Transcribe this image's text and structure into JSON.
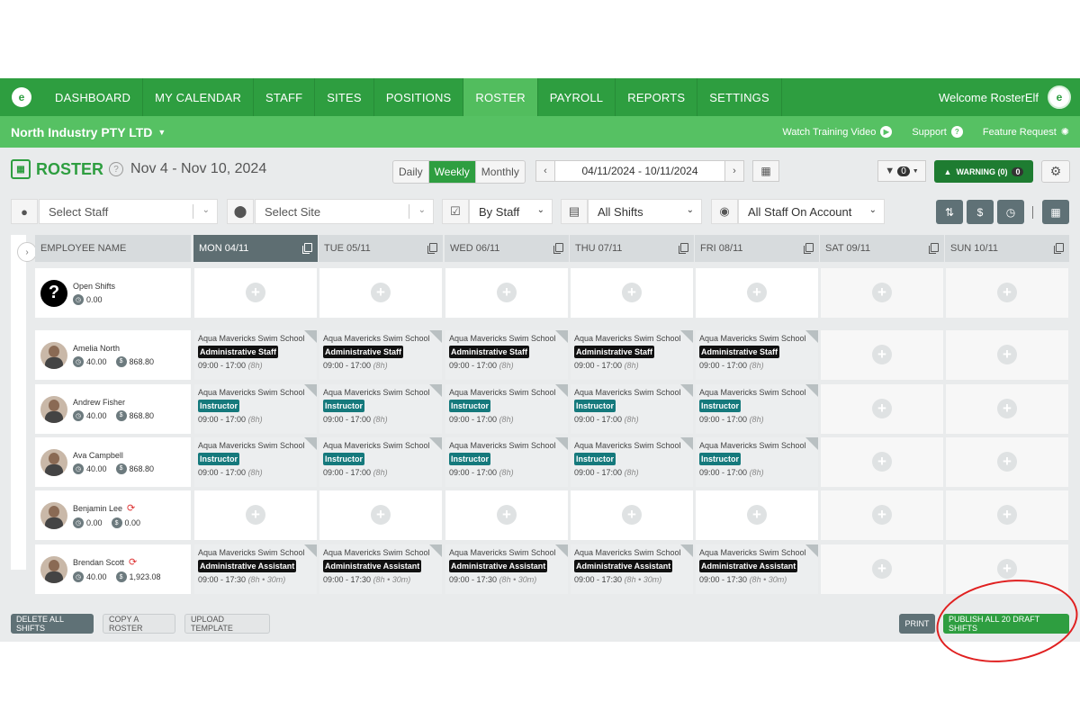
{
  "nav": {
    "items": [
      "DASHBOARD",
      "MY CALENDAR",
      "STAFF",
      "SITES",
      "POSITIONS",
      "ROSTER",
      "PAYROLL",
      "REPORTS",
      "SETTINGS"
    ],
    "active": "ROSTER",
    "welcome": "Welcome RosterElf"
  },
  "subnav": {
    "company": "North Industry PTY LTD",
    "training": "Watch Training Video",
    "support": "Support",
    "feature": "Feature Request"
  },
  "header": {
    "title": "ROSTER",
    "date_range": "Nov 4 - Nov 10, 2024",
    "view_daily": "Daily",
    "view_weekly": "Weekly",
    "view_monthly": "Monthly",
    "date_field": "04/11/2024 - 10/11/2024",
    "filter_count": "0",
    "warning_label": "WARNING (0)",
    "warning_count": "0"
  },
  "filters": {
    "staff_placeholder": "Select Staff",
    "site_placeholder": "Select Site",
    "group_by": "By Staff",
    "shifts": "All Shifts",
    "visibility": "All Staff On Account"
  },
  "grid": {
    "employee_header": "EMPLOYEE NAME",
    "days": [
      "MON 04/11",
      "TUE 05/11",
      "WED 06/11",
      "THU 07/11",
      "FRI 08/11",
      "SAT 09/11",
      "SUN 10/11"
    ],
    "active_day": 0,
    "open_shifts": {
      "label": "Open Shifts",
      "hours": "0.00"
    },
    "employees": [
      {
        "name": "Amelia North",
        "hours": "40.00",
        "cost": "868.80",
        "sync": false,
        "shift_kind": "admin"
      },
      {
        "name": "Andrew Fisher",
        "hours": "40.00",
        "cost": "868.80",
        "sync": false,
        "shift_kind": "instr"
      },
      {
        "name": "Ava Campbell",
        "hours": "40.00",
        "cost": "868.80",
        "sync": false,
        "shift_kind": "instr"
      },
      {
        "name": "Benjamin Lee",
        "hours": "0.00",
        "cost": "0.00",
        "sync": true,
        "shift_kind": "none"
      },
      {
        "name": "Brendan Scott",
        "hours": "40.00",
        "cost": "1,923.08",
        "sync": true,
        "shift_kind": "assist"
      }
    ],
    "shift_templates": {
      "admin": {
        "site": "Aqua Mavericks Swim School",
        "position": "Administrative Staff",
        "time": "09:00 - 17:00",
        "duration": "(8h)"
      },
      "instr": {
        "site": "Aqua Mavericks Swim School",
        "position": "Instructor",
        "time": "09:00 - 17:00",
        "duration": "(8h)"
      },
      "assist": {
        "site": "Aqua Mavericks Swim School",
        "position": "Administrative Assistant",
        "time": "09:00 - 17:30",
        "duration": "(8h • 30m)"
      }
    }
  },
  "footer": {
    "delete_all": "DELETE ALL SHIFTS",
    "copy_roster": "COPY A ROSTER",
    "upload_template": "UPLOAD TEMPLATE",
    "print": "PRINT",
    "publish": "PUBLISH ALL 20 DRAFT SHIFTS"
  },
  "colors": {
    "primary_green": "#2e9e40",
    "light_green": "#56c163",
    "instructor_teal": "#15797c",
    "annotation_red": "#e02020"
  }
}
